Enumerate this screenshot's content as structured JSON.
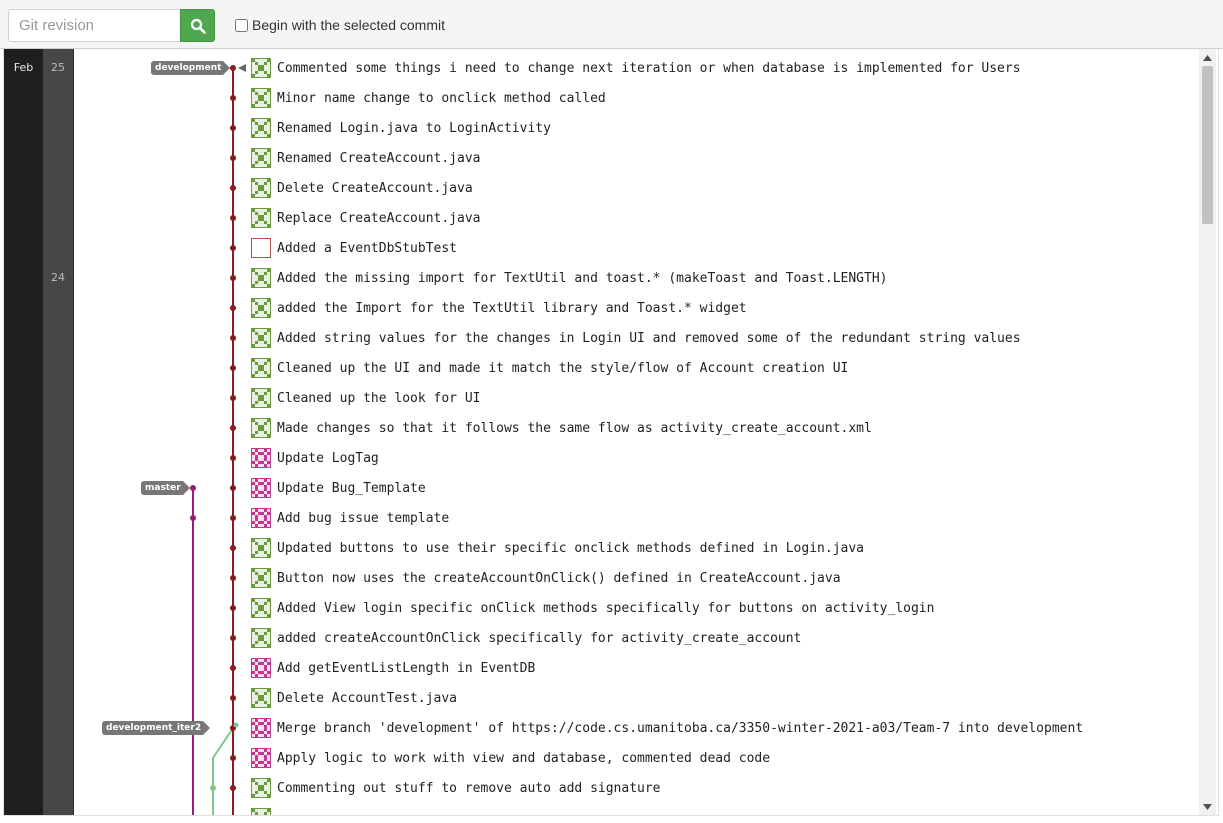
{
  "toolbar": {
    "revision_placeholder": "Git revision",
    "search_icon": "search-icon",
    "begin_label": "Begin with the selected commit",
    "begin_checked": false
  },
  "timeline": {
    "month": "Feb",
    "days": [
      {
        "label": "25",
        "row": 0
      },
      {
        "label": "24",
        "row": 7
      }
    ]
  },
  "refs": [
    {
      "label": "development",
      "row": 0,
      "lane": "development"
    },
    {
      "label": "master",
      "row": 14,
      "lane": "master"
    },
    {
      "label": "development_iter2",
      "row": 22,
      "lane": "development_iter2"
    }
  ],
  "colors": {
    "development": "#8b1a1a",
    "master": "#9c1b7a",
    "development_iter2": "#7bc88f",
    "avatar_green": "#6b9a3c",
    "avatar_pink": "#c4378f",
    "avatar_blank_border": "#b05050"
  },
  "commits": [
    {
      "message": "Commented some things i need to change next iteration or when database is implemented for Users",
      "avatar": "green"
    },
    {
      "message": "Minor name change to onclick method called",
      "avatar": "green"
    },
    {
      "message": "Renamed Login.java to LoginActivity",
      "avatar": "green"
    },
    {
      "message": "Renamed CreateAccount.java",
      "avatar": "green"
    },
    {
      "message": "Delete CreateAccount.java",
      "avatar": "green"
    },
    {
      "message": "Replace CreateAccount.java",
      "avatar": "green"
    },
    {
      "message": "Added a EventDbStubTest",
      "avatar": "blank"
    },
    {
      "message": "Added the missing import for TextUtil and toast.* (makeToast and Toast.LENGTH)",
      "avatar": "green"
    },
    {
      "message": "added the Import for the TextUtil library and Toast.* widget",
      "avatar": "green"
    },
    {
      "message": "Added string values for the changes in Login UI and removed some of the redundant string values",
      "avatar": "green"
    },
    {
      "message": "Cleaned up the UI and made it match the style/flow of Account creation UI",
      "avatar": "green"
    },
    {
      "message": "Cleaned up the look for UI",
      "avatar": "green"
    },
    {
      "message": "Made changes so that it follows the same flow as activity_create_account.xml",
      "avatar": "green"
    },
    {
      "message": "Update LogTag",
      "avatar": "pink"
    },
    {
      "message": "Update Bug_Template",
      "avatar": "pink"
    },
    {
      "message": "Add bug issue template",
      "avatar": "pink"
    },
    {
      "message": "Updated buttons to use their specific onclick methods defined in Login.java",
      "avatar": "green"
    },
    {
      "message": "Button now uses the createAccountOnClick() defined in CreateAccount.java",
      "avatar": "green"
    },
    {
      "message": "Added View login specific onClick methods specifically for buttons on activity_login",
      "avatar": "green"
    },
    {
      "message": "added createAccountOnClick specifically for activity_create_account",
      "avatar": "green"
    },
    {
      "message": "Add getEventListLength in EventDB",
      "avatar": "pink"
    },
    {
      "message": "Delete AccountTest.java",
      "avatar": "green"
    },
    {
      "message": "Merge branch 'development' of https://code.cs.umanitoba.ca/3350-winter-2021-a03/Team-7 into development",
      "avatar": "pink"
    },
    {
      "message": "Apply logic to work with view and database, commented dead code",
      "avatar": "pink"
    },
    {
      "message": "Commenting out stuff to remove auto add signature",
      "avatar": "green"
    },
    {
      "message": "",
      "avatar": "green"
    }
  ],
  "scrollbar": {
    "position": 0.0
  }
}
